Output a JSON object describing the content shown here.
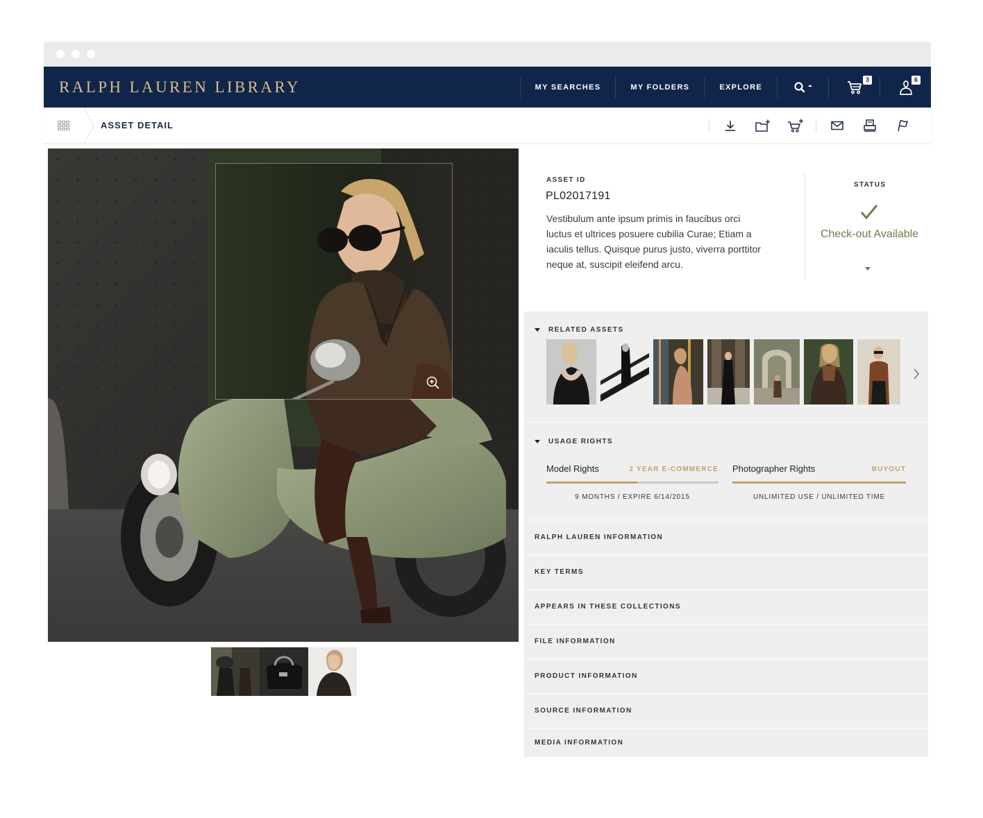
{
  "brand": "RALPH LAUREN LIBRARY",
  "nav": {
    "my_searches": "MY SEARCHES",
    "my_folders": "MY FOLDERS",
    "explore": "EXPLORE",
    "cart_count": "3",
    "user_count": "6"
  },
  "subbar": {
    "breadcrumb": "ASSET DETAIL"
  },
  "asset": {
    "id_label": "ASSET ID",
    "id": "PL02017191",
    "description": "Vestibulum ante ipsum primis in faucibus orci luctus et ultrices posuere cubilia Curae; Etiam a iaculis tellus. Quisque purus justo, viverra porttitor neque at, suscipit eleifend arcu.",
    "status_label": "STATUS",
    "status": "Check-out Available"
  },
  "sections": {
    "related_assets": "RELATED ASSETS",
    "usage_rights": "USAGE RIGHTS",
    "collapsed": [
      "RALPH LAUREN INFORMATION",
      "KEY TERMS",
      "APPEARS IN THESE COLLECTIONS",
      "FILE INFORMATION",
      "PRODUCT INFORMATION",
      "SOURCE INFORMATION",
      "MEDIA INFORMATION"
    ]
  },
  "usage": {
    "model": {
      "name": "Model Rights",
      "tag": "2 YEAR E-COMMERCE",
      "meta": "9 MONTHS  /  EXPIRE 6/14/2015",
      "progress": 0.53
    },
    "photographer": {
      "name": "Photographer Rights",
      "tag": "BUYOUT",
      "meta": "UNLIMITED USE  /  UNLIMITED TIME",
      "progress": 1.0
    }
  },
  "icons": {
    "search": "search-icon",
    "cart": "cart-icon",
    "user": "user-icon",
    "download": "download-icon",
    "add_to_folder": "add-to-folder-icon",
    "add_to_cart": "add-to-cart-icon",
    "email": "email-icon",
    "print": "print-icon",
    "flag": "flag-icon",
    "zoom": "zoom-in-icon"
  },
  "colors": {
    "nav_bg": "#10254a",
    "brand_gold": "#d7bf8c",
    "status_green": "#6b7d4d",
    "rights_gold": "#bfa06c"
  }
}
